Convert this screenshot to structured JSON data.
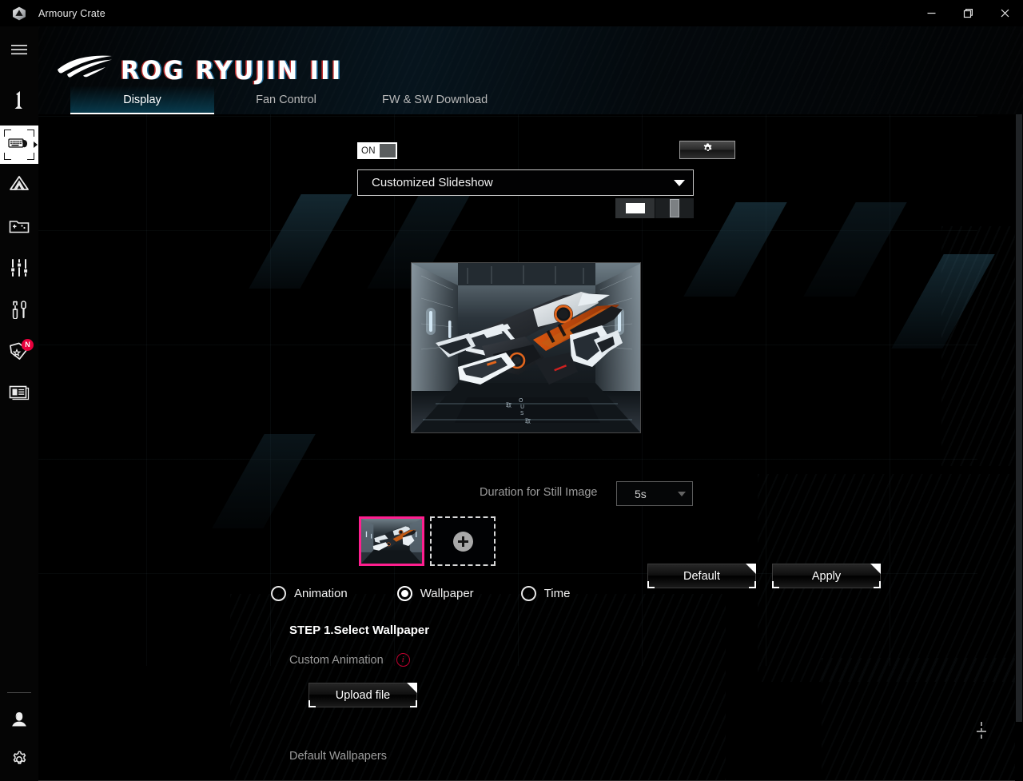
{
  "titlebar": {
    "app_icon": "armoury-crate-logo",
    "title": "Armoury Crate",
    "minimize": "minimize-icon",
    "maximize": "restore-icon",
    "close": "close-icon"
  },
  "sidebar": {
    "items": [
      {
        "icon": "hamburger-menu-icon",
        "name": "menu"
      },
      {
        "icon": "dashboard-info-icon",
        "name": "dashboard"
      },
      {
        "icon": "keyboard-mouse-device-icon",
        "name": "devices",
        "selected": true
      },
      {
        "icon": "aura-sync-icon",
        "name": "aura-sync"
      },
      {
        "icon": "game-library-icon",
        "name": "game-library"
      },
      {
        "icon": "scenario-sliders-icon",
        "name": "scenario-profiles"
      },
      {
        "icon": "tools-wrench-icon",
        "name": "tools"
      },
      {
        "icon": "featured-tag-icon",
        "name": "featured",
        "badge": "N"
      },
      {
        "icon": "news-card-icon",
        "name": "news"
      }
    ],
    "bottom_items": [
      {
        "icon": "user-account-icon",
        "name": "user-account"
      },
      {
        "icon": "gear-settings-icon",
        "name": "settings"
      }
    ]
  },
  "header": {
    "brand_logo": "rog-eye-logo",
    "product_title": "ROG RYUJIN III"
  },
  "tabs": [
    {
      "label": "Display",
      "active": true
    },
    {
      "label": "Fan Control",
      "active": false
    },
    {
      "label": "FW & SW Download",
      "active": false
    }
  ],
  "display_panel": {
    "power_toggle": {
      "label": "ON",
      "state": "on"
    },
    "settings_button": {
      "icon": "gear-icon"
    },
    "mode_select": {
      "value": "Customized Slideshow",
      "caret": "chevron-down-icon"
    },
    "orientation": [
      {
        "name": "landscape",
        "selected": true
      },
      {
        "name": "portrait",
        "selected": false
      }
    ],
    "preview": {
      "alt": "ryujin-cooler-wallpaper-preview"
    },
    "duration": {
      "label": "Duration for Still Image",
      "value": "5s",
      "caret": "chevron-down-icon"
    },
    "thumbnails": [
      {
        "name": "wallpaper-thumbnail-1",
        "selected": true
      }
    ],
    "add_tile": {
      "icon": "plus-icon"
    },
    "radio_group": [
      {
        "label": "Animation",
        "checked": false
      },
      {
        "label": "Wallpaper",
        "checked": true
      },
      {
        "label": "Time",
        "checked": false
      }
    ],
    "step_title": "STEP 1.Select Wallpaper",
    "custom_animation": {
      "label": "Custom Animation",
      "info_icon": "info-icon"
    },
    "upload_button": "Upload file",
    "default_button": "Default",
    "apply_button": "Apply",
    "default_wallpapers_label": "Default Wallpapers"
  },
  "colors": {
    "accent_pink": "#ff1f8f",
    "accent_teal": "#09465c",
    "badge_red": "#e8003c",
    "info_red": "#c0002f",
    "background": "#000000"
  }
}
